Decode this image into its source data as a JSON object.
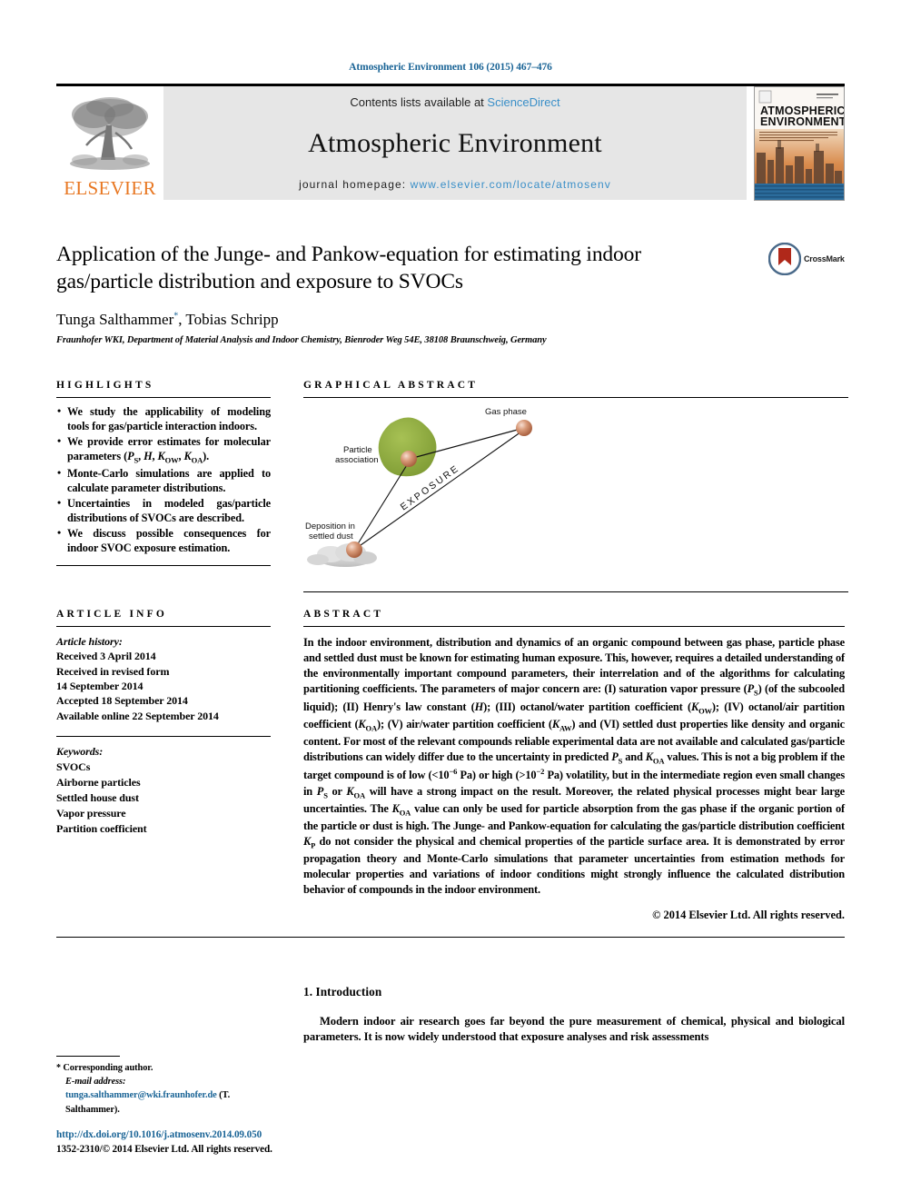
{
  "running_head": "Atmospheric Environment 106 (2015) 467–476",
  "masthead": {
    "publisher_name": "ELSEVIER",
    "contents_prefix": "Contents lists available at ",
    "contents_link": "ScienceDirect",
    "journal_title": "Atmospheric Environment",
    "homepage_prefix": "journal homepage: ",
    "homepage_url": "www.elsevier.com/locate/atmosenv",
    "cover_title_line1": "ATMOSPHERIC",
    "cover_title_line2": "ENVIRONMENT"
  },
  "article": {
    "title": "Application of the Junge- and Pankow-equation for estimating indoor gas/particle distribution and exposure to SVOCs",
    "authors": "Tunga Salthammer",
    "authors_rest": ", Tobias Schripp",
    "corresponding_marker": "*",
    "affiliation": "Fraunhofer WKI, Department of Material Analysis and Indoor Chemistry, Bienroder Weg 54E, 38108 Braunschweig, Germany",
    "crossmark_label": "CrossMark"
  },
  "highlights": {
    "heading": "HIGHLIGHTS",
    "items": [
      "We study the applicability of modeling tools for gas/particle interaction indoors.",
      "We provide error estimates for molecular parameters (PS, H, KOW, KOA).",
      "Monte-Carlo simulations are applied to calculate parameter distributions.",
      "Uncertainties in modeled gas/particle distributions of SVOCs are described.",
      "We discuss possible consequences for indoor SVOC exposure estimation."
    ]
  },
  "graphical_abstract": {
    "heading": "GRAPHICAL ABSTRACT",
    "labels": {
      "gas_phase": "Gas phase",
      "particle_association_line1": "Particle",
      "particle_association_line2": "association",
      "deposition_line1": "Deposition in",
      "deposition_line2": "settled dust",
      "exposure": "EXPOSURE"
    },
    "colors": {
      "sphere": "#cf8162",
      "particle_blob": "#8aa63c",
      "dust_cloud": "#c9c9c9"
    }
  },
  "article_info": {
    "heading": "ARTICLE INFO",
    "history_label": "Article history:",
    "history": [
      "Received 3 April 2014",
      "Received in revised form",
      "14 September 2014",
      "Accepted 18 September 2014",
      "Available online 22 September 2014"
    ],
    "keywords_label": "Keywords:",
    "keywords": [
      "SVOCs",
      "Airborne particles",
      "Settled house dust",
      "Vapor pressure",
      "Partition coefficient"
    ]
  },
  "abstract": {
    "heading": "ABSTRACT",
    "paragraph_1": "In the indoor environment, distribution and dynamics of an organic compound between gas phase, particle phase and settled dust must be known for estimating human exposure. This, however, requires a detailed understanding of the environmentally important compound parameters, their interrelation and of the algorithms for calculating partitioning coefficients. The parameters of major concern are: (I) saturation vapor pressure (PS) (of the subcooled liquid); (II) Henry's law constant (H); (III) octanol/water partition coefficient (KOW); (IV) octanol/air partition coefficient (KOA); (V) air/water partition coefficient (KAW) and (VI) settled dust properties like density and organic content. For most of the relevant compounds reliable experimental data are not available and calculated gas/particle distributions can widely differ due to the uncertainty in predicted PS and KOA values. This is not a big problem if the target compound is of low (<10−6 Pa) or high (>10−2 Pa) volatility, but in the intermediate region even small changes in PS or KOA will have a strong impact on the result. Moreover, the related physical processes might bear large uncertainties. The KOA value can only be used for particle absorption from the gas phase if the organic portion of the particle or dust is high. The Junge- and Pankow-equation for calculating the gas/particle distribution coefficient KP do not consider the physical and chemical properties of the particle surface area. It is demonstrated by error propagation theory and Monte-Carlo simulations that parameter uncertainties from estimation methods for molecular properties and variations of indoor conditions might strongly influence the calculated distribution behavior of compounds in the indoor environment.",
    "copyright": "© 2014 Elsevier Ltd. All rights reserved."
  },
  "introduction": {
    "heading": "1. Introduction",
    "paragraph": "Modern indoor air research goes far beyond the pure measurement of chemical, physical and biological parameters. It is now widely understood that exposure analyses and risk assessments"
  },
  "footer": {
    "corresponding_star": "*",
    "corresponding_label": "Corresponding author.",
    "email_label": "E-mail address:",
    "email": "tunga.salthammer@wki.fraunhofer.de",
    "email_attrib": "(T. Salthammer).",
    "doi": "http://dx.doi.org/10.1016/j.atmosenv.2014.09.050",
    "issn_line": "1352-2310/© 2014 Elsevier Ltd. All rights reserved."
  },
  "colors": {
    "link": "#1a6496",
    "elsevier_orange": "#e87722",
    "sciencedirect_blue": "#3a8fc8",
    "masthead_gray": "#e6e6e6"
  }
}
